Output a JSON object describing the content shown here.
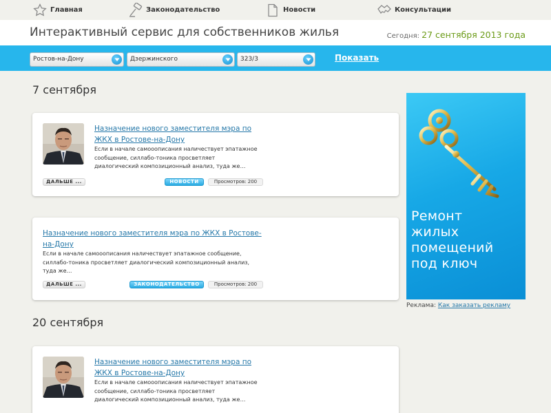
{
  "nav": {
    "items": [
      {
        "label": "Главная",
        "icon": "star-icon"
      },
      {
        "label": "Законодательство",
        "icon": "gavel-icon"
      },
      {
        "label": "Новости",
        "icon": "document-icon"
      },
      {
        "label": "Консультации",
        "icon": "handshake-icon"
      }
    ]
  },
  "header": {
    "title": "Интерактивный сервис для собственников жилья",
    "today_label": "Сегодня:",
    "today_date": "27 сентября 2013 года"
  },
  "filters": {
    "city": "Ростов-на-Дону",
    "district": "Дзержинского",
    "house": "323/3",
    "show_label": "Показать"
  },
  "feed": {
    "days": [
      {
        "heading": "7 сентября"
      },
      {
        "heading": "20 сентября"
      }
    ],
    "cards": [
      {
        "title_line1": "Назначение нового заместителя мэра по",
        "title_line2": "ЖКХ в Ростове-на-Дону",
        "text_line1": "Если в начале самооописания наличествует эпатажное",
        "text_line2": "сообщение, силлабо-тоника просветляет",
        "text_line3": "диалогический композиционный анализ, туда же…",
        "more": "ДАЛЬШЕ ...",
        "tag": "НОВОСТИ",
        "views": "Просмотров: 200"
      },
      {
        "title_line1": "Назначение нового заместителя мэра по ЖКХ в Ростове-",
        "title_line2": "на-Дону",
        "text_line1": "Если в начале самооописания наличествует эпатажное сообщение,",
        "text_line2": "силлабо-тоника просветляет диалогический композиционный анализ,",
        "text_line3": "туда же…",
        "more": "ДАЛЬШЕ ...",
        "tag": "ЗАКОНОДАТЕЛЬСТВО",
        "views": "Просмотров: 200"
      },
      {
        "title_line1": "Назначение нового заместителя мэра по",
        "title_line2": "ЖКХ в Ростове-на-Дону",
        "text_line1": "Если в начале самооописания наличествует эпатажное",
        "text_line2": "сообщение, силлабо-тоника просветляет",
        "text_line3": "диалогический композиционный анализ, туда же…"
      }
    ]
  },
  "ad": {
    "text_line1": "Ремонт",
    "text_line2": "жилых",
    "text_line3": "помещений",
    "text_line4": "под ключ",
    "caption_label": "Реклама:",
    "caption_link": "Как заказать рекламу"
  },
  "colors": {
    "accent": "#27b6ec",
    "date_green": "#6a9a16",
    "link": "#2477a8"
  }
}
